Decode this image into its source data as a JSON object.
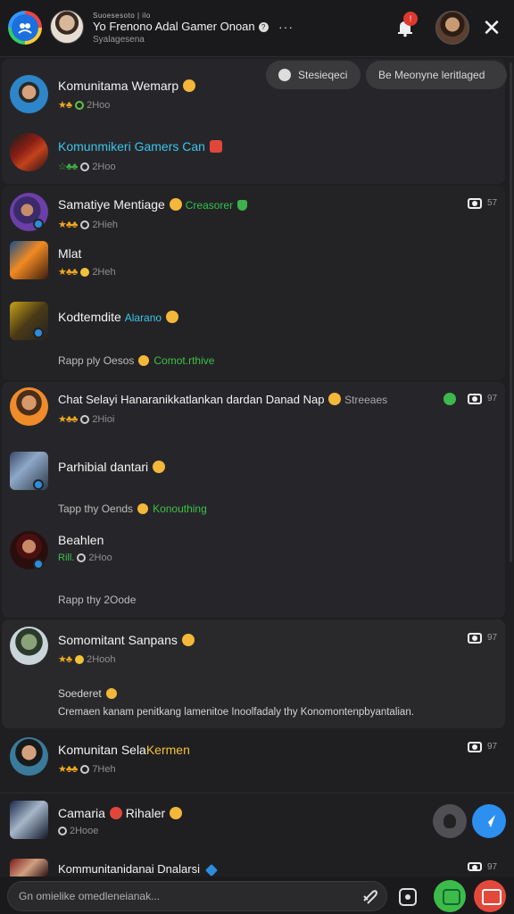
{
  "header": {
    "sub_top": "Suoesesoto | ilo",
    "title": "Yo Frenono Adal Gamer Onoan",
    "help_glyph": "?",
    "sub_bottom": "Syalagesena",
    "more_glyph": "···",
    "notif_badge": "!",
    "close_glyph": "✕"
  },
  "pills": {
    "pill1": "Stesieqeci",
    "pill2": "Be Meonyne leritlaged"
  },
  "items": [
    {
      "title": "Komunitama Wemarp",
      "stars": "★♣",
      "meta": "2Hoo"
    },
    {
      "title": "Komunmikeri Gamers Can",
      "stars": "☆♣♣",
      "meta": "2Hoo"
    },
    {
      "title": "Samatiye Mentiage",
      "tag": "Creasorer",
      "stars": "★♣♣",
      "meta": "2Hieh",
      "count": "57"
    },
    {
      "title": "Mlat",
      "stars": "★♣♣",
      "meta": "2Heh"
    },
    {
      "title": "Kodtemdite",
      "tag": "Alarano",
      "sub_prefix": "Rapp ply Oesos",
      "sub_green": "Comot.rthive"
    },
    {
      "title": "Chat Selayi Hanaranikkatlankan dardan Danad Nap",
      "tag": "Streeaes",
      "stars": "★♣♣",
      "meta": "2Hioi",
      "count": "97"
    },
    {
      "title": "Parhibial dantari",
      "sub_prefix": "Tapp thy Oends",
      "sub_green": "Konouthing"
    },
    {
      "title": "Beahlen",
      "meta_green": "Rill.",
      "meta": "2Hoo"
    },
    {
      "sub_prefix": "Rapp thy 2Oode"
    },
    {
      "title": "Somomitant Sanpans",
      "stars": "★♣",
      "meta": "2Hooh",
      "count": "97",
      "body1": "Soederet",
      "body2": "Cremaen kanam penitkang lamenitoe Inoolfadaly thy Konomontenpbyantalian."
    },
    {
      "title_prefix": "Komunitan Sela",
      "title_hl": "Kermen",
      "stars": "★♣♣",
      "meta": "7Heh",
      "count": "97"
    },
    {
      "title": "Camaria",
      "title_mid": "Rihaler",
      "meta": "2Hooe"
    },
    {
      "title": "Kommunitanidanai Dnalarsi",
      "count": "97"
    }
  ],
  "composer": {
    "placeholder": "Gn omielike omedleneianak..."
  },
  "icons": [
    "app-logo-icon",
    "help-icon",
    "more-icon",
    "bell-icon",
    "close-icon",
    "camera-icon",
    "chat-icon",
    "attach-icon",
    "gift-icon",
    "sticker-icon",
    "video-icon",
    "send-icon",
    "react-icon"
  ]
}
